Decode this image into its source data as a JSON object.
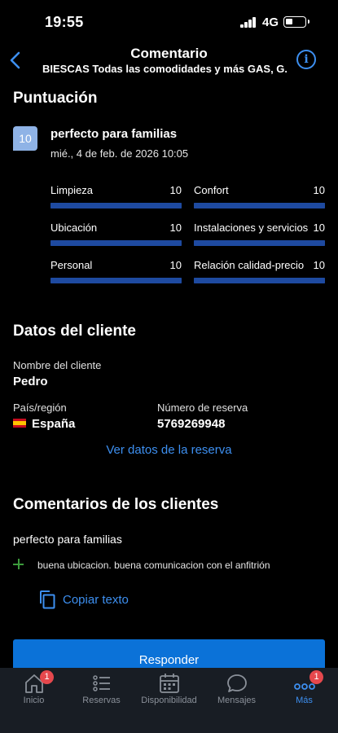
{
  "status_bar": {
    "time": "19:55",
    "network": "4G"
  },
  "header": {
    "title": "Comentario",
    "subtitle": "BIESCAS Todas las comodidades y más GAS, G..."
  },
  "rating": {
    "section_title": "Puntuación",
    "score": "10",
    "review_title": "perfecto para familias",
    "date": "mié., 4 de feb. de 2026 10:05",
    "categories": [
      {
        "label": "Limpieza",
        "score": "10",
        "fill": 1.0
      },
      {
        "label": "Confort",
        "score": "10",
        "fill": 1.0
      },
      {
        "label": "Ubicación",
        "score": "10",
        "fill": 1.0
      },
      {
        "label": "Instalaciones y servicios",
        "score": "10",
        "fill": 1.0
      },
      {
        "label": "Personal",
        "score": "10",
        "fill": 1.0
      },
      {
        "label": "Relación calidad-precio",
        "score": "10",
        "fill": 1.0
      }
    ]
  },
  "client": {
    "section_title": "Datos del cliente",
    "name_label": "Nombre del cliente",
    "name": "Pedro",
    "country_label": "País/región",
    "country": "España",
    "booking_label": "Número de reserva",
    "booking_number": "5769269948",
    "view_booking_link": "Ver datos de la reserva"
  },
  "comments": {
    "section_title": "Comentarios de los clientes",
    "title": "perfecto para familias",
    "positive": "buena ubicacion. buena comunicacion con el anfitrión",
    "copy_label": "Copiar texto"
  },
  "respond_button": "Responder",
  "tabbar": {
    "items": [
      {
        "label": "Inicio",
        "icon": "home-icon",
        "badge": "1"
      },
      {
        "label": "Reservas",
        "icon": "list-icon"
      },
      {
        "label": "Disponibilidad",
        "icon": "calendar-icon"
      },
      {
        "label": "Mensajes",
        "icon": "chat-bubble-icon"
      },
      {
        "label": "Más",
        "icon": "more-dots-icon",
        "badge": "1",
        "active": true
      }
    ]
  },
  "colors": {
    "accent": "#3d8ff0",
    "bar": "#1e4aa0",
    "button": "#0b72d8",
    "badge": "#e5484d"
  }
}
